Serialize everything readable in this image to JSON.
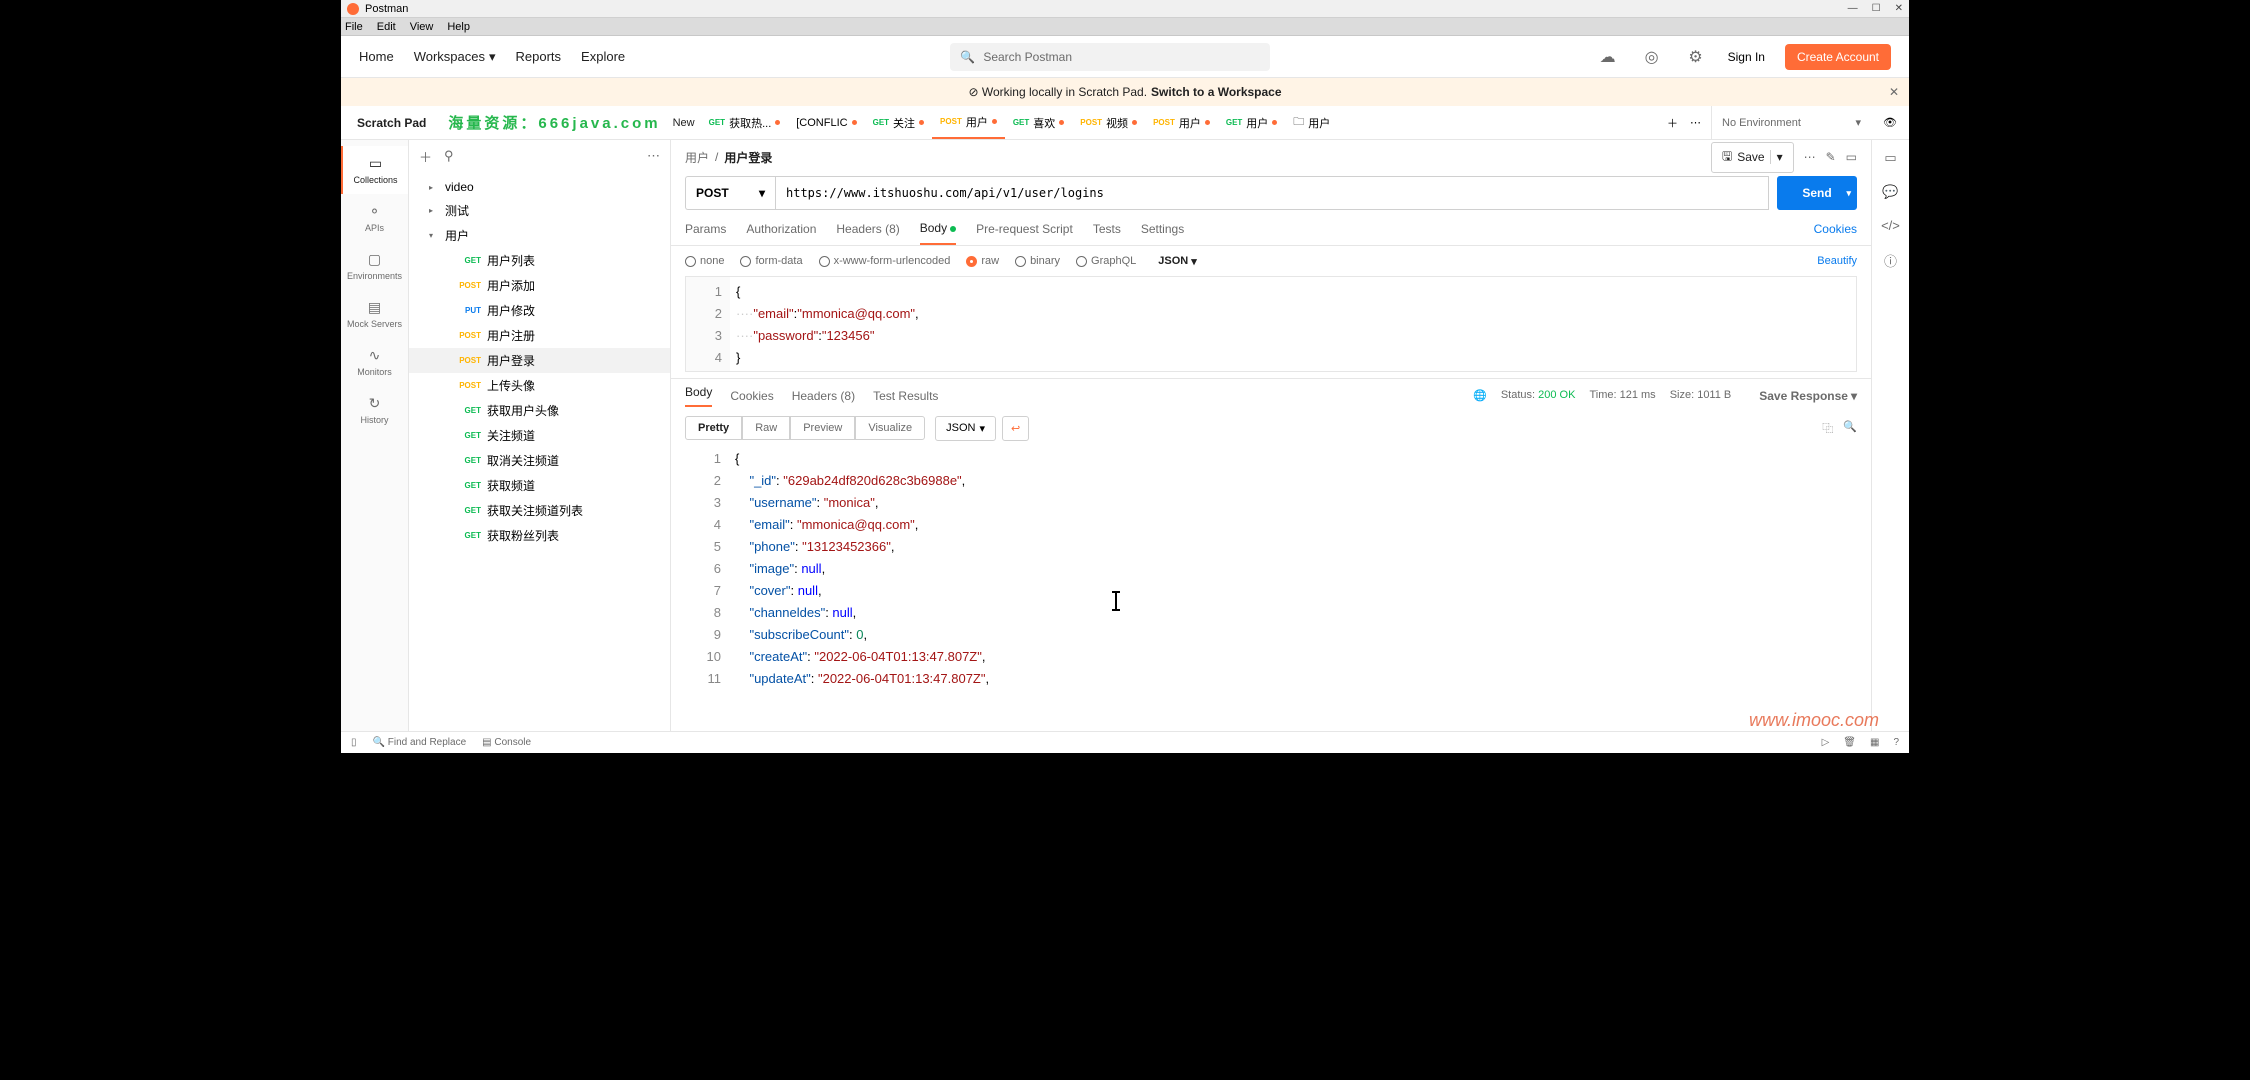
{
  "title": "Postman",
  "menubar": [
    "File",
    "Edit",
    "View",
    "Help"
  ],
  "topnav": {
    "items": [
      "Home",
      "Workspaces",
      "Reports",
      "Explore"
    ],
    "search_placeholder": "Search Postman",
    "signin": "Sign In",
    "create": "Create Account"
  },
  "banner": {
    "text": "Working locally in Scratch Pad.",
    "link": "Switch to a Workspace"
  },
  "scratch_label": "Scratch Pad",
  "watermark_green": "海量资源：666java.com",
  "new_label": "New",
  "tabs": [
    {
      "method": "GET",
      "label": "获取热..."
    },
    {
      "method": "",
      "label": "[CONFLIC"
    },
    {
      "method": "GET",
      "label": "关注"
    },
    {
      "method": "POST",
      "label": "用户"
    },
    {
      "method": "GET",
      "label": "喜欢"
    },
    {
      "method": "POST",
      "label": "视频"
    },
    {
      "method": "POST",
      "label": "用户"
    },
    {
      "method": "GET",
      "label": "用户"
    },
    {
      "method": "",
      "label": "用户"
    }
  ],
  "env": "No Environment",
  "leftrail": [
    "Collections",
    "APIs",
    "Environments",
    "Mock Servers",
    "Monitors",
    "History"
  ],
  "sidebar": {
    "folders": [
      {
        "name": "video",
        "open": false
      },
      {
        "name": "测试",
        "open": false
      },
      {
        "name": "用户",
        "open": true
      }
    ],
    "items": [
      {
        "method": "GET",
        "name": "用户列表"
      },
      {
        "method": "POST",
        "name": "用户添加"
      },
      {
        "method": "PUT",
        "name": "用户修改"
      },
      {
        "method": "POST",
        "name": "用户注册"
      },
      {
        "method": "POST",
        "name": "用户登录",
        "sel": true
      },
      {
        "method": "POST",
        "name": "上传头像"
      },
      {
        "method": "GET",
        "name": "获取用户头像"
      },
      {
        "method": "GET",
        "name": "关注频道"
      },
      {
        "method": "GET",
        "name": "取消关注频道"
      },
      {
        "method": "GET",
        "name": "获取频道"
      },
      {
        "method": "GET",
        "name": "获取关注频道列表"
      },
      {
        "method": "GET",
        "name": "获取粉丝列表"
      }
    ]
  },
  "crumb": {
    "parent": "用户",
    "current": "用户登录",
    "save": "Save"
  },
  "request": {
    "method": "POST",
    "url": "https://www.itshuoshu.com/api/v1/user/logins",
    "send": "Send",
    "tabs": [
      "Params",
      "Authorization",
      "Headers (8)",
      "Body",
      "Pre-request Script",
      "Tests",
      "Settings"
    ],
    "cookies": "Cookies",
    "body_opts": [
      "none",
      "form-data",
      "x-www-form-urlencoded",
      "raw",
      "binary",
      "GraphQL"
    ],
    "json_label": "JSON",
    "beautify": "Beautify",
    "body_json": {
      "email": "mmonica@qq.com",
      "password": "123456"
    }
  },
  "response": {
    "tabs": [
      "Body",
      "Cookies",
      "Headers (8)",
      "Test Results"
    ],
    "status": "Status: 200 OK",
    "time": "Time: 121 ms",
    "size": "Size: 1011 B",
    "save": "Save Response",
    "view_opts": [
      "Pretty",
      "Raw",
      "Preview",
      "Visualize"
    ],
    "json_label": "JSON",
    "body": {
      "_id": "629ab24df820d628c3b6988e",
      "username": "monica",
      "email": "mmonica@qq.com",
      "phone": "13123452366",
      "image": null,
      "cover": null,
      "channeldes": null,
      "subscribeCount": 0,
      "createAt": "2022-06-04T01:13:47.807Z",
      "updateAt": "2022-06-04T01:13:47.807Z"
    }
  },
  "statusbar": {
    "find": "Find and Replace",
    "console": "Console"
  },
  "wm_orange": "www.imooc.com"
}
